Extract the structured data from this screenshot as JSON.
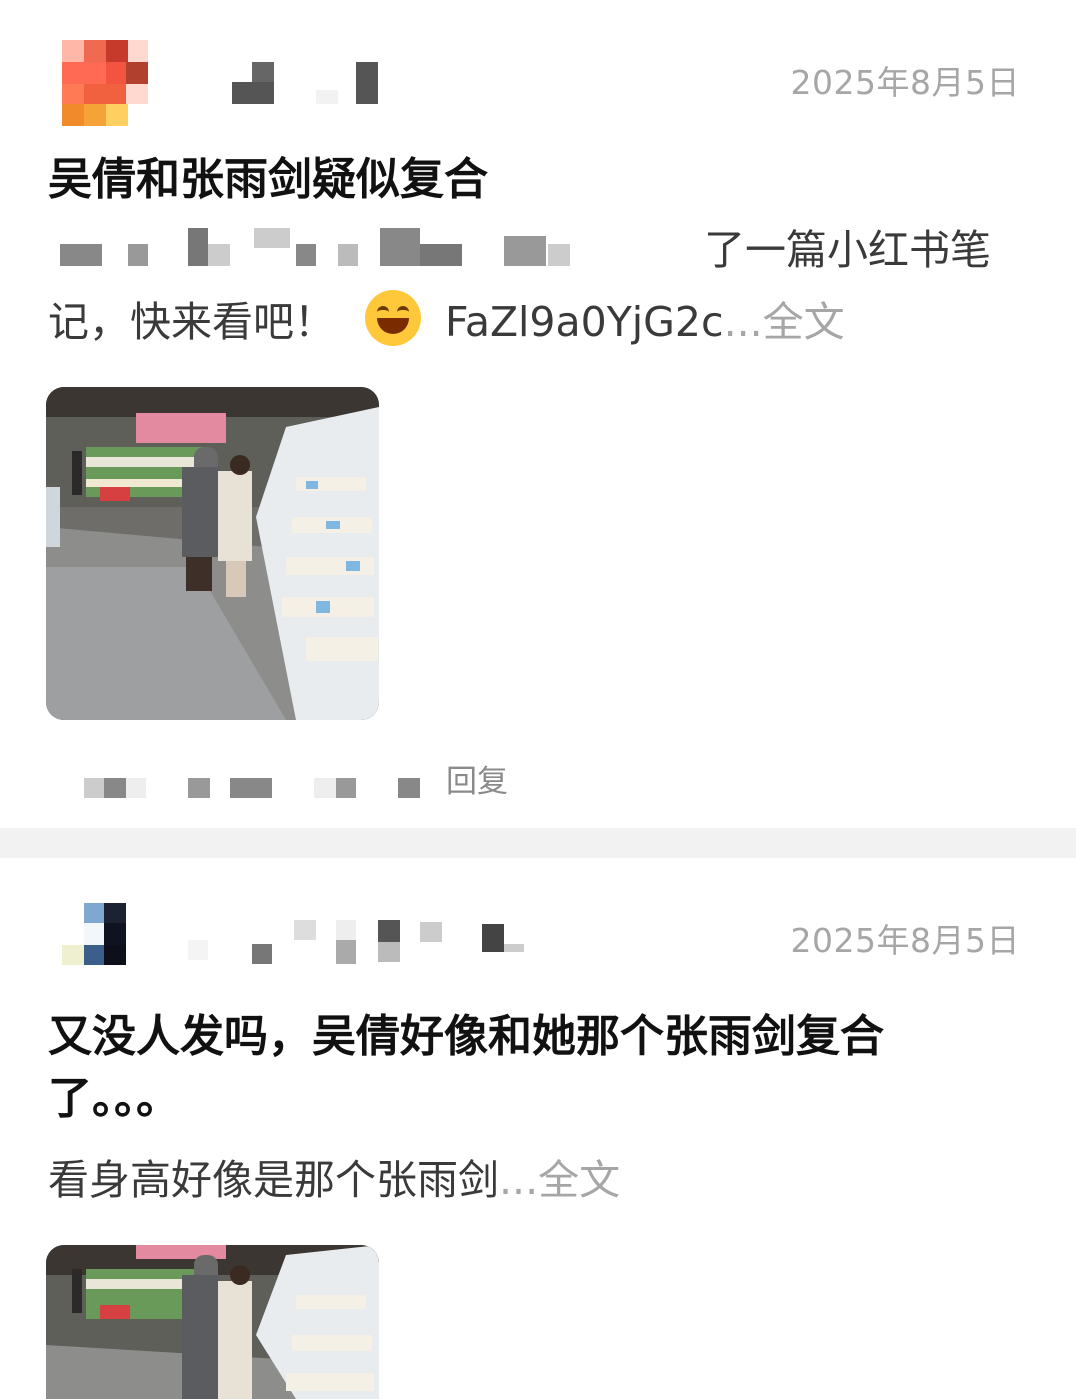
{
  "posts": [
    {
      "date": "2025年8月5日",
      "title": "吴倩和张雨剑疑似复合",
      "body_line1_tail": "了一篇小红书笔",
      "body_line2": "记，快来看吧！",
      "emoji": "grinning-squinting-face",
      "link_text": "FaZl9a0YjG2c",
      "ellipsis": "...",
      "more_label": "全文",
      "reply_label": "回复"
    },
    {
      "date": "2025年8月5日",
      "title_line1": "又没人发吗，吴倩好像和她那个张雨剑复合",
      "title_line2": "了。。。",
      "body": "看身高好像是那个张雨剑",
      "ellipsis": "...",
      "more_label": "全文"
    }
  ],
  "colors": {
    "date": "#a6a6a6",
    "more": "#a6a6a6",
    "separator": "#f2f2f2",
    "title": "#111111",
    "body": "#3a3a3a"
  }
}
